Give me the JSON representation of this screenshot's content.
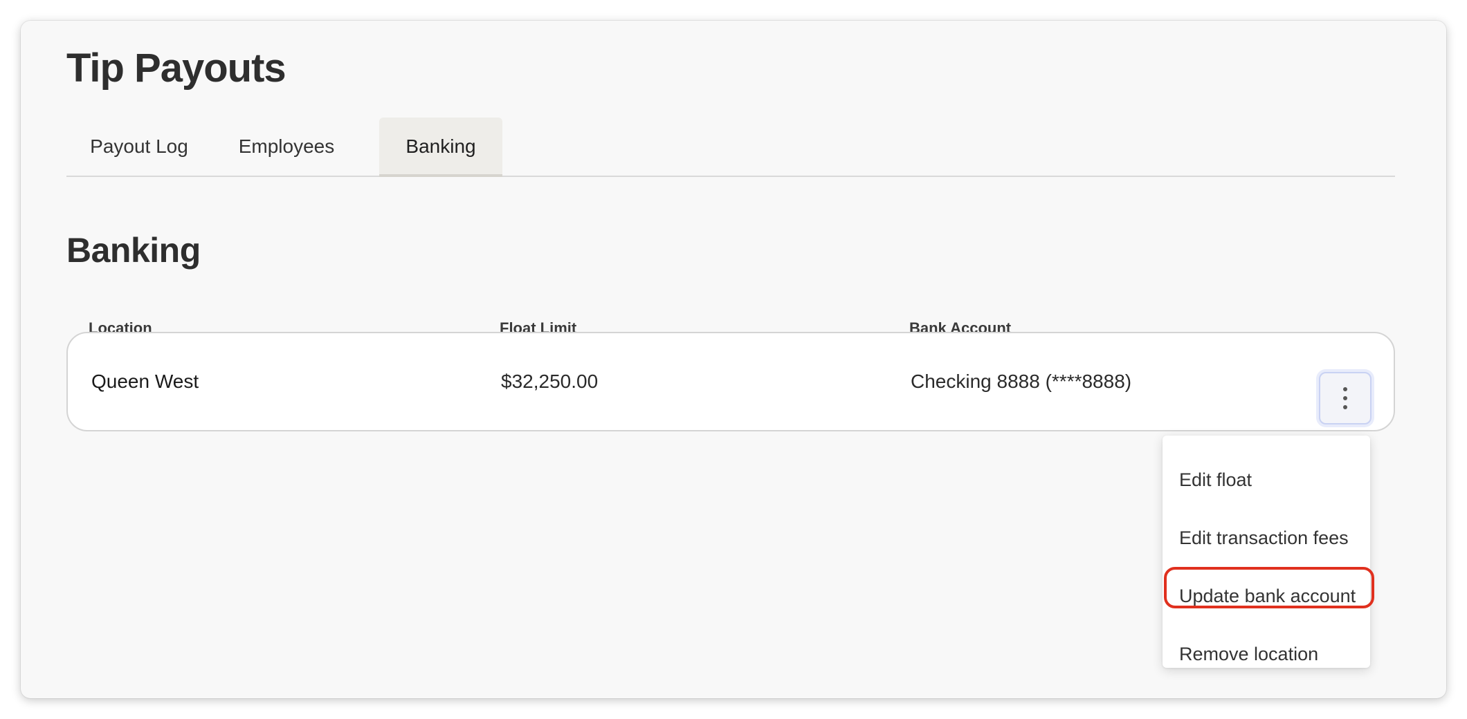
{
  "page": {
    "title": "Tip Payouts"
  },
  "tabs": [
    {
      "label": "Payout Log",
      "active": false
    },
    {
      "label": "Employees",
      "active": false
    },
    {
      "label": "Banking",
      "active": true
    }
  ],
  "banking": {
    "section_title": "Banking",
    "columns": [
      "Location",
      "Float Limit",
      "Bank Account"
    ],
    "rows": [
      {
        "location": "Queen West",
        "float_limit": "$32,250.00",
        "bank_account": "Checking 8888 (****8888)"
      }
    ]
  },
  "row_menu": {
    "items": [
      {
        "label": "Edit float"
      },
      {
        "label": "Edit transaction fees"
      },
      {
        "label": "Update bank account",
        "highlighted": true
      },
      {
        "label": "Remove location"
      }
    ]
  },
  "icons": {
    "row_menu_button": "more-vertical-icon"
  },
  "colors": {
    "highlight_outline": "#e0301e",
    "active_tab_bg": "#eeede9",
    "focus_ring": "#c9d2f3"
  }
}
